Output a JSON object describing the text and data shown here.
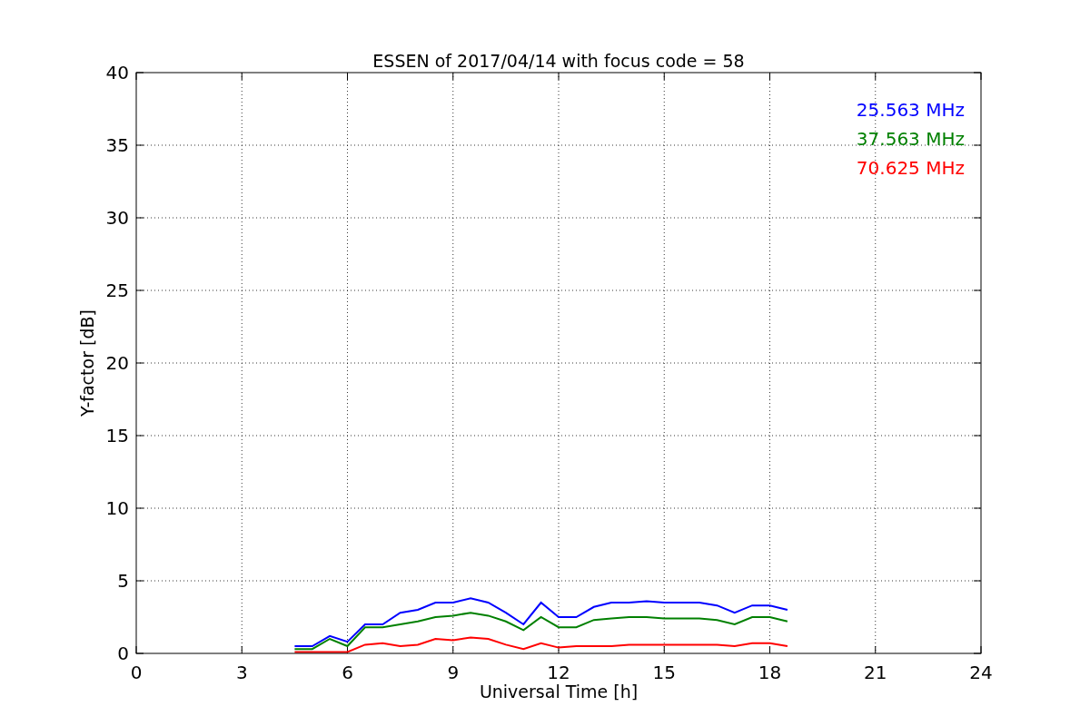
{
  "chart_data": {
    "type": "line",
    "title": "ESSEN of 2017/04/14 with focus code = 58",
    "xlabel": "Universal Time [h]",
    "ylabel": "Y-factor [dB]",
    "x": [
      4.5,
      5,
      5.5,
      6,
      6.5,
      7,
      7.5,
      8,
      8.5,
      9,
      9.5,
      10,
      10.5,
      11,
      11.5,
      12,
      12.5,
      13,
      13.5,
      14,
      14.5,
      15,
      15.5,
      16,
      16.5,
      17,
      17.5,
      18,
      18.5
    ],
    "series": [
      {
        "name": "25.563 MHz",
        "color": "#0000ff",
        "values": [
          0.5,
          0.5,
          1.2,
          0.8,
          2.0,
          2.0,
          2.8,
          3.0,
          3.5,
          3.5,
          3.8,
          3.5,
          2.8,
          2.0,
          3.5,
          2.5,
          2.5,
          3.2,
          3.5,
          3.5,
          3.6,
          3.5,
          3.5,
          3.5,
          3.3,
          2.8,
          3.3,
          3.3,
          3.0
        ]
      },
      {
        "name": "37.563 MHz",
        "color": "#008000",
        "values": [
          0.3,
          0.3,
          1.0,
          0.5,
          1.8,
          1.8,
          2.0,
          2.2,
          2.5,
          2.6,
          2.8,
          2.6,
          2.2,
          1.6,
          2.5,
          1.8,
          1.8,
          2.3,
          2.4,
          2.5,
          2.5,
          2.4,
          2.4,
          2.4,
          2.3,
          2.0,
          2.5,
          2.5,
          2.2
        ]
      },
      {
        "name": "70.625 MHz",
        "color": "#ff0000",
        "values": [
          0.1,
          0.1,
          0.1,
          0.1,
          0.6,
          0.7,
          0.5,
          0.6,
          1.0,
          0.9,
          1.1,
          1.0,
          0.6,
          0.3,
          0.7,
          0.4,
          0.5,
          0.5,
          0.5,
          0.6,
          0.6,
          0.6,
          0.6,
          0.6,
          0.6,
          0.5,
          0.7,
          0.7,
          0.5
        ]
      }
    ],
    "grid": true,
    "xlim": [
      0,
      24
    ],
    "ylim": [
      0,
      40
    ],
    "xticks": [
      0,
      3,
      6,
      9,
      12,
      15,
      18,
      21,
      24
    ],
    "yticks": [
      0,
      5,
      10,
      15,
      20,
      25,
      30,
      35,
      40
    ]
  }
}
